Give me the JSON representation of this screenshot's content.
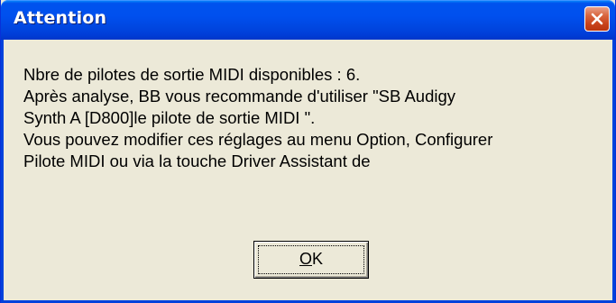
{
  "window": {
    "title": "Attention"
  },
  "message": {
    "lines": [
      "Nbre de pilotes de sortie MIDI disponibles : 6.",
      "Après analyse, BB vous recommande d'utiliser \"SB Audigy",
      "Synth A [D800]le pilote de sortie MIDI \".",
      "Vous pouvez modifier ces réglages au menu Option, Configurer",
      "Pilote MIDI ou via la touche Driver Assistant de"
    ]
  },
  "buttons": {
    "ok": {
      "mnemonic": "O",
      "rest": "K"
    }
  },
  "icons": {
    "close": "close-icon"
  },
  "colors": {
    "titlebar": "#0050ee",
    "close_button": "#c9431b",
    "dialog_background": "#ece9d8"
  }
}
